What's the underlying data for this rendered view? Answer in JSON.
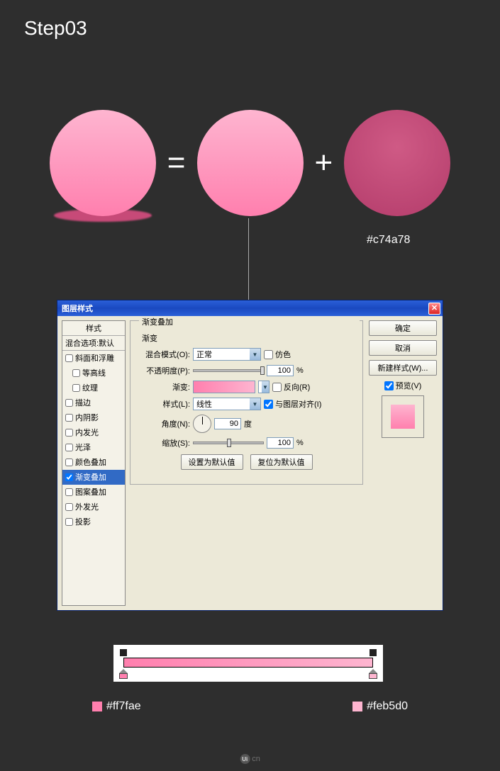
{
  "step_title": "Step03",
  "shadow_hex": "#c74a78",
  "dialog": {
    "title": "图层样式",
    "ok": "确定",
    "cancel": "取消",
    "new_style": "新建样式(W)...",
    "preview_label": "预览(V)"
  },
  "sidebar": {
    "styles": "样式",
    "blend_default": "混合选项:默认",
    "bevel": "斜面和浮雕",
    "contour": "等高线",
    "texture": "纹理",
    "stroke_s": "描边",
    "inner_shadow": "内阴影",
    "inner_glow": "内发光",
    "satin": "光泽",
    "color_overlay": "颜色叠加",
    "gradient_overlay": "渐变叠加",
    "pattern_overlay": "图案叠加",
    "outer_glow": "外发光",
    "drop_shadow": "投影"
  },
  "panel": {
    "group_title": "渐变叠加",
    "sub_title": "渐变",
    "blend_mode_label": "混合模式(O):",
    "blend_mode_value": "正常",
    "dither_label": "仿色",
    "opacity_label": "不透明度(P):",
    "opacity_value": "100",
    "percent": "%",
    "gradient_label": "渐变:",
    "reverse_label": "反向(R)",
    "style_label": "样式(L):",
    "style_value": "线性",
    "align_label": "与图层对齐(I)",
    "angle_label": "角度(N):",
    "angle_value": "90",
    "angle_unit": "度",
    "scale_label": "缩放(S):",
    "scale_value": "100",
    "set_default": "设置为默认值",
    "reset_default": "复位为默认值"
  },
  "gradient_stops": {
    "left": "#ff7fae",
    "right": "#feb5d0"
  },
  "watermark": "cn"
}
